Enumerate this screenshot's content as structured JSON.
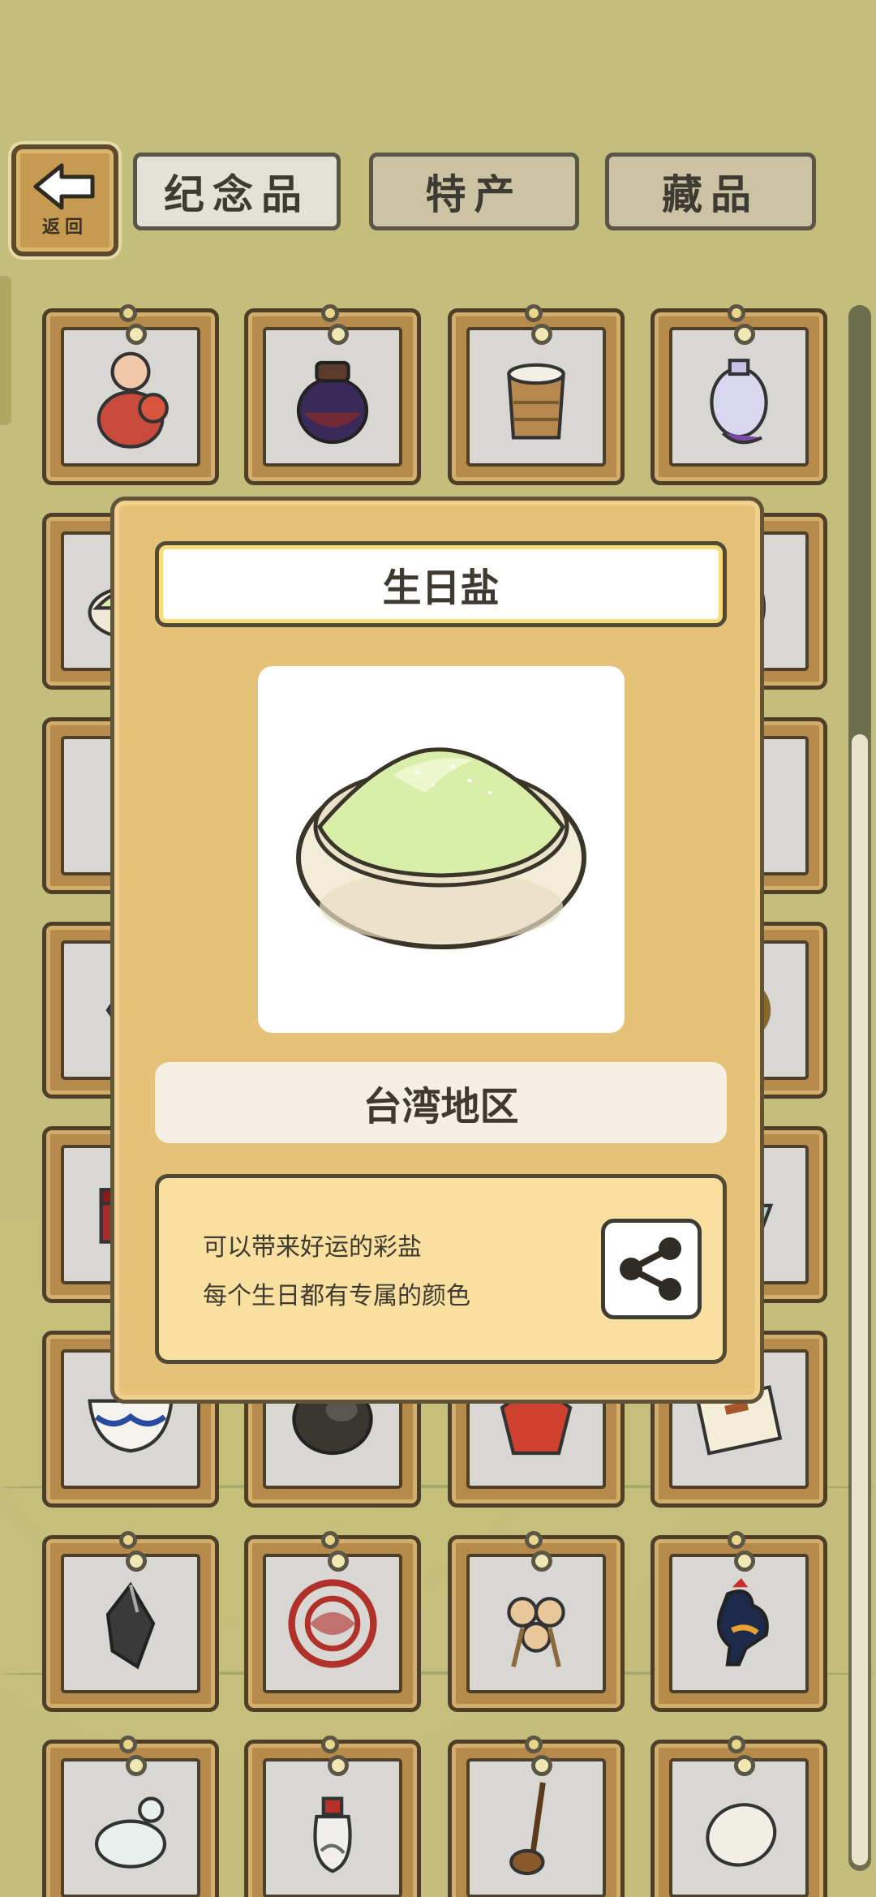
{
  "header": {
    "back_label": "返回",
    "tabs": [
      {
        "label": "纪念品",
        "active": true
      },
      {
        "label": "特产",
        "active": false
      },
      {
        "label": "藏品",
        "active": false
      }
    ]
  },
  "grid_items": [
    {
      "icon": "clay-doll-icon"
    },
    {
      "icon": "lidded-jar-icon"
    },
    {
      "icon": "woven-cup-icon"
    },
    {
      "icon": "cloisonne-vase-icon"
    },
    {
      "icon": "salt-bowl-icon"
    },
    {
      "icon": "hidden-icon"
    },
    {
      "icon": "hidden-icon"
    },
    {
      "icon": "porcelain-vase-icon"
    },
    {
      "icon": "bead-bracelet-icon"
    },
    {
      "icon": "hidden-icon"
    },
    {
      "icon": "hidden-icon"
    },
    {
      "icon": "hidden-icon"
    },
    {
      "icon": "red-ornament-icon"
    },
    {
      "icon": "hidden-icon"
    },
    {
      "icon": "hidden-icon"
    },
    {
      "icon": "brass-ring-icon"
    },
    {
      "icon": "lacquer-box-icon"
    },
    {
      "icon": "hidden-icon"
    },
    {
      "icon": "hidden-icon"
    },
    {
      "icon": "celadon-bowl-icon"
    },
    {
      "icon": "blue-white-bowl-icon"
    },
    {
      "icon": "ink-stone-icon"
    },
    {
      "icon": "red-paper-cut-icon"
    },
    {
      "icon": "certificate-icon"
    },
    {
      "icon": "black-stone-pendant-icon"
    },
    {
      "icon": "red-paper-medallion-icon"
    },
    {
      "icon": "rabbit-skewer-icon"
    },
    {
      "icon": "rooster-figurine-icon"
    },
    {
      "icon": "jade-frog-icon"
    },
    {
      "icon": "snuff-bottle-icon"
    },
    {
      "icon": "string-instrument-icon"
    },
    {
      "icon": "white-egg-stone-icon"
    }
  ],
  "modal": {
    "title": "生日盐",
    "item_icon": "salt-bowl-icon",
    "region": "台湾地区",
    "description": [
      "可以带来好运的彩盐",
      "每个生日都有专属的颜色"
    ],
    "share_icon": "share-icon"
  },
  "colors": {
    "background": "#c5bd7c",
    "frame_wood": "#b58a4a",
    "modal_bg": "#e6c278",
    "salt_green": "#d9efa9"
  }
}
